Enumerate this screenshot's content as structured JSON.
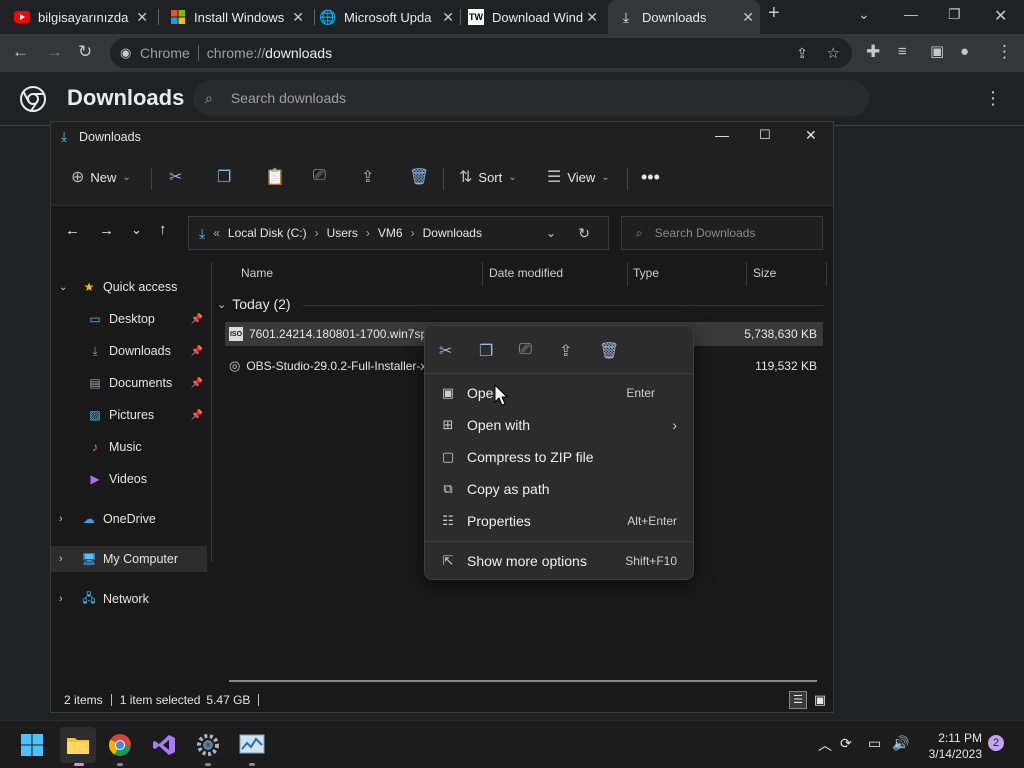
{
  "browser": {
    "tabs": [
      {
        "title": "bilgisayarınızda",
        "icon": "youtube-icon"
      },
      {
        "title": "Install Windows",
        "icon": "microsoft-icon"
      },
      {
        "title": "Microsoft Upda",
        "icon": "globe-icon"
      },
      {
        "title": "Download Wind",
        "icon": "tw-icon"
      },
      {
        "title": "Downloads",
        "icon": "download-icon",
        "active": true
      }
    ],
    "omnibox": {
      "prefix": "Chrome",
      "scheme": "chrome://",
      "host": "downloads"
    }
  },
  "downloads_page": {
    "title": "Downloads",
    "search_placeholder": "Search downloads"
  },
  "explorer": {
    "title": "Downloads",
    "commands": {
      "new": "New",
      "sort": "Sort",
      "view": "View"
    },
    "breadcrumb": [
      "Local Disk (C:)",
      "Users",
      "VM6",
      "Downloads"
    ],
    "search_placeholder": "Search Downloads",
    "sidebar": [
      {
        "label": "Quick access",
        "icon": "star-icon"
      },
      {
        "label": "Desktop",
        "icon": "desktop-icon",
        "pinned": true
      },
      {
        "label": "Downloads",
        "icon": "download-icon",
        "pinned": true
      },
      {
        "label": "Documents",
        "icon": "documents-icon",
        "pinned": true
      },
      {
        "label": "Pictures",
        "icon": "pictures-icon",
        "pinned": true
      },
      {
        "label": "Music",
        "icon": "music-icon"
      },
      {
        "label": "Videos",
        "icon": "videos-icon"
      },
      {
        "label": "OneDrive",
        "icon": "cloud-icon"
      },
      {
        "label": "My Computer",
        "icon": "computer-icon",
        "selected": true
      },
      {
        "label": "Network",
        "icon": "network-icon"
      }
    ],
    "columns": {
      "name": "Name",
      "date": "Date modified",
      "type": "Type",
      "size": "Size"
    },
    "group": "Today (2)",
    "files": [
      {
        "name": "7601.24214.180801-1700.win7sp1_",
        "size": "5,738,630 KB",
        "selected": true,
        "icon": "iso-file-icon"
      },
      {
        "name": "OBS-Studio-29.0.2-Full-Installer-x",
        "size": "119,532 KB",
        "selected": false,
        "icon": "obs-installer-icon"
      }
    ],
    "status": {
      "items": "2 items",
      "selected": "1 item selected",
      "size": "5.47 GB"
    }
  },
  "context_menu": {
    "items": [
      {
        "label": "Open",
        "shortcut": "Enter",
        "icon": "open-icon"
      },
      {
        "label": "Open with",
        "shortcut": "",
        "icon": "open-with-icon",
        "submenu": true
      },
      {
        "label": "Compress to ZIP file",
        "shortcut": "",
        "icon": "zip-icon"
      },
      {
        "label": "Copy as path",
        "shortcut": "",
        "icon": "copy-path-icon"
      },
      {
        "label": "Properties",
        "shortcut": "Alt+Enter",
        "icon": "properties-icon"
      },
      {
        "label": "Show more options",
        "shortcut": "Shift+F10",
        "icon": "more-options-icon"
      }
    ]
  },
  "taskbar": {
    "time": "2:11 PM",
    "date": "3/14/2023",
    "notifications": "2"
  },
  "colors": {
    "accent": "#0078d4",
    "selection": "#3a3a3a"
  }
}
